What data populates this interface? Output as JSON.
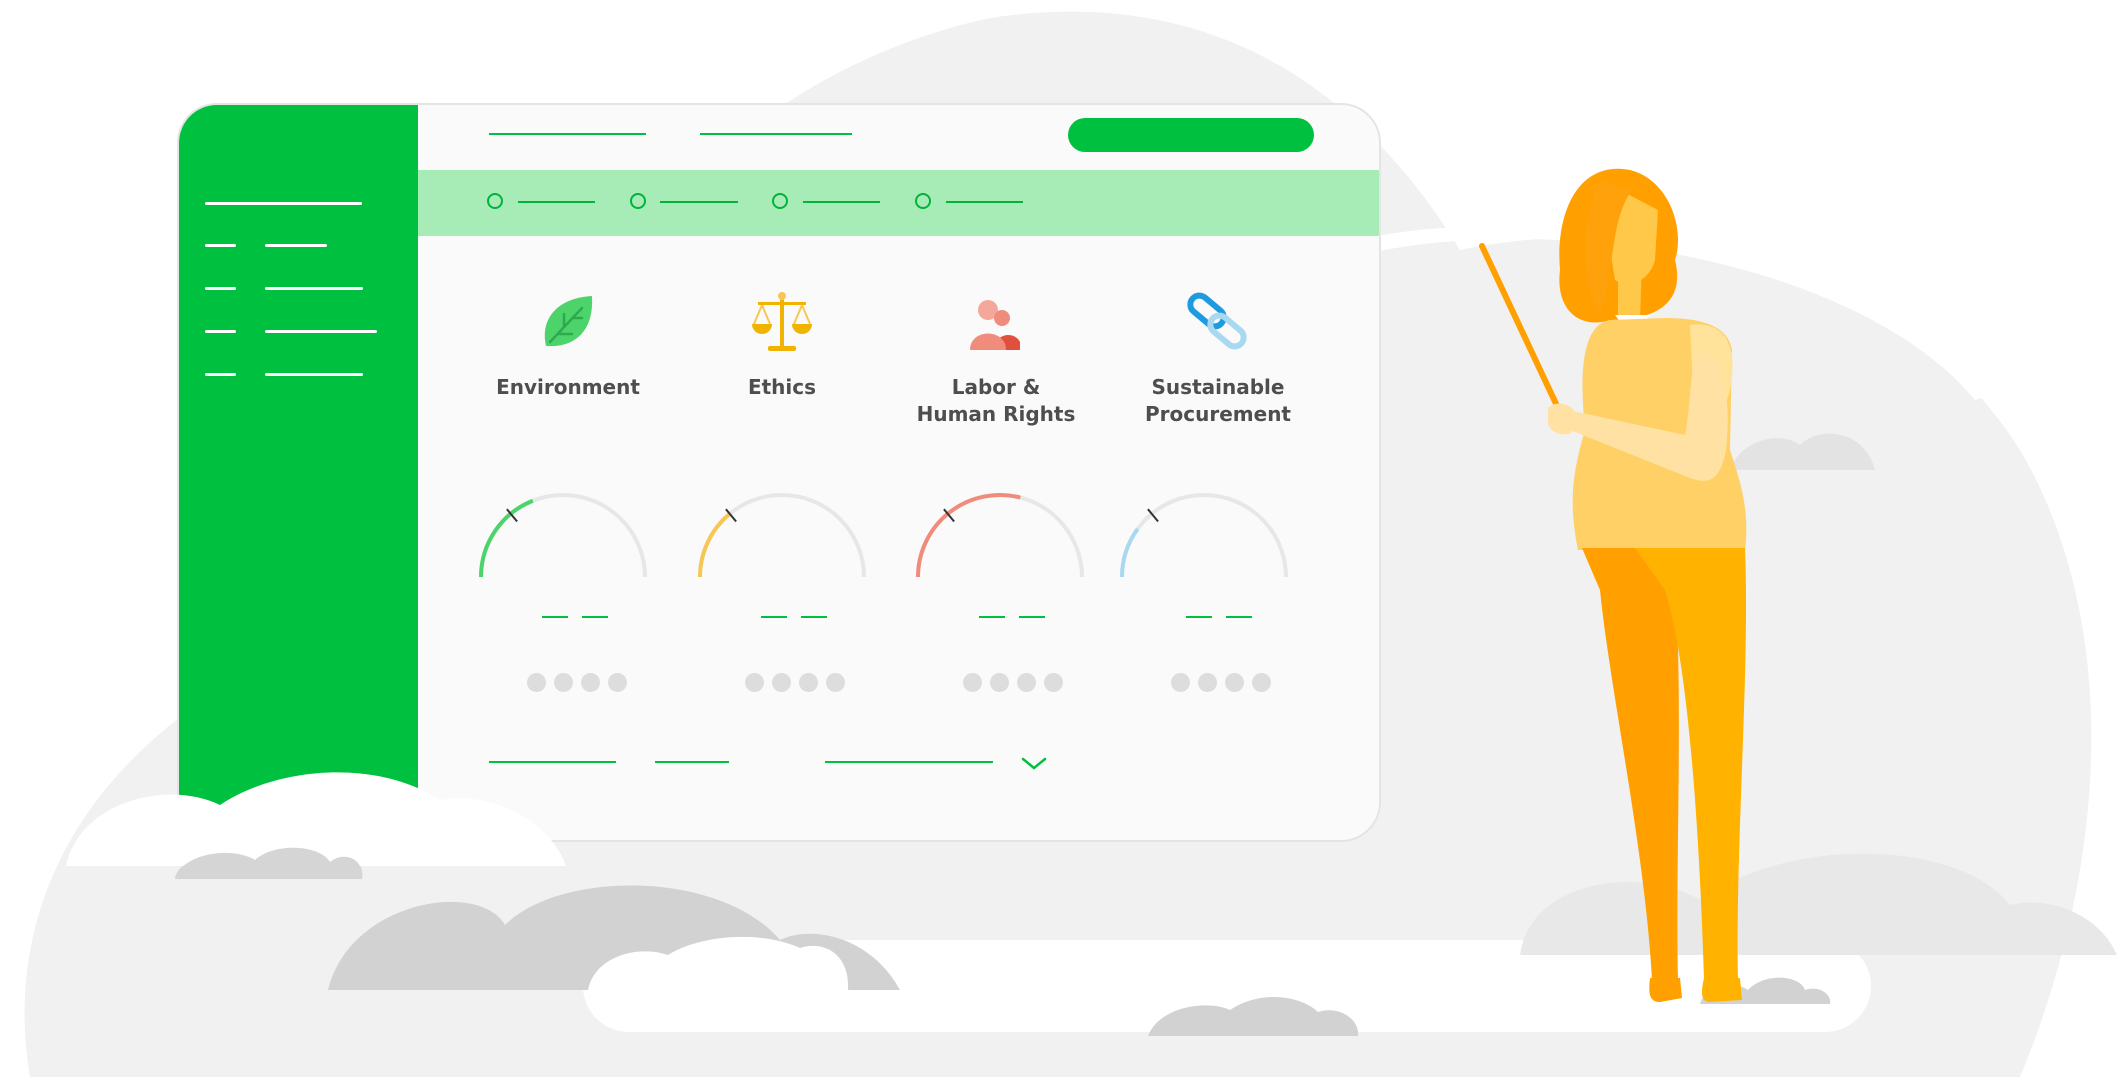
{
  "colors": {
    "brand_green": "#00c13f",
    "stepper_bg": "#a7ebb7",
    "environment": "#4cd46a",
    "ethics": "#f6c755",
    "labor": "#ef8c7c",
    "procurement": "#a9d9f0",
    "track": "#e7e7e7",
    "woman_hair": "#ff9f00",
    "woman_top": "#ffd066",
    "woman_pants": "#ffb300"
  },
  "categories": [
    {
      "label": "Environment",
      "icon": "leaf-icon",
      "color": "#4cd46a",
      "score": 0.38
    },
    {
      "label": "Ethics",
      "icon": "scales-icon",
      "color": "#f6c755",
      "score": 0.28
    },
    {
      "label": "Labor &\nHuman Rights",
      "icon": "people-icon",
      "color": "#ef8c7c",
      "score": 0.58
    },
    {
      "label": "Sustainable\nProcurement",
      "icon": "chain-link-icon",
      "color": "#a9d9f0",
      "score": 0.2
    }
  ]
}
